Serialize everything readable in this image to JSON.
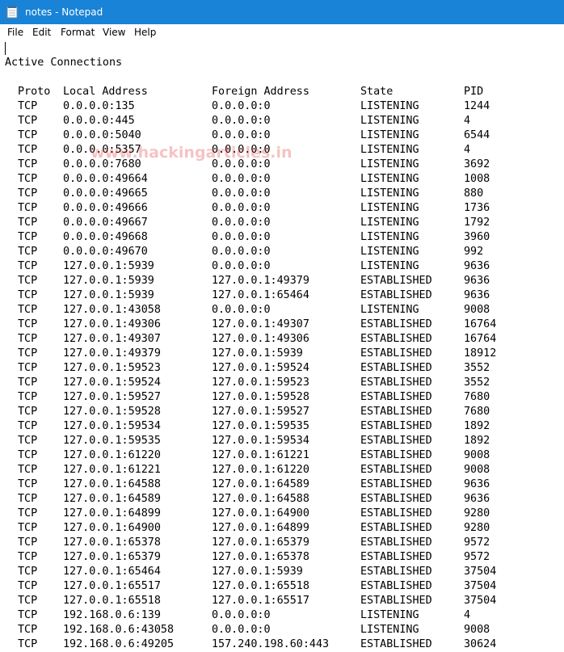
{
  "window": {
    "title": "notes - Notepad",
    "titlebar_color": "#1883d7"
  },
  "menu": [
    "File",
    "Edit",
    "Format",
    "View",
    "Help"
  ],
  "content": {
    "heading": "Active Connections",
    "watermark": "www.hackingarticles.in",
    "columns": [
      "Proto",
      "Local Address",
      "Foreign Address",
      "State",
      "PID"
    ],
    "rows": [
      [
        "TCP",
        "0.0.0.0:135",
        "0.0.0.0:0",
        "LISTENING",
        "1244"
      ],
      [
        "TCP",
        "0.0.0.0:445",
        "0.0.0.0:0",
        "LISTENING",
        "4"
      ],
      [
        "TCP",
        "0.0.0.0:5040",
        "0.0.0.0:0",
        "LISTENING",
        "6544"
      ],
      [
        "TCP",
        "0.0.0.0:5357",
        "0.0.0.0:0",
        "LISTENING",
        "4"
      ],
      [
        "TCP",
        "0.0.0.0:7680",
        "0.0.0.0:0",
        "LISTENING",
        "3692"
      ],
      [
        "TCP",
        "0.0.0.0:49664",
        "0.0.0.0:0",
        "LISTENING",
        "1008"
      ],
      [
        "TCP",
        "0.0.0.0:49665",
        "0.0.0.0:0",
        "LISTENING",
        "880"
      ],
      [
        "TCP",
        "0.0.0.0:49666",
        "0.0.0.0:0",
        "LISTENING",
        "1736"
      ],
      [
        "TCP",
        "0.0.0.0:49667",
        "0.0.0.0:0",
        "LISTENING",
        "1792"
      ],
      [
        "TCP",
        "0.0.0.0:49668",
        "0.0.0.0:0",
        "LISTENING",
        "3960"
      ],
      [
        "TCP",
        "0.0.0.0:49670",
        "0.0.0.0:0",
        "LISTENING",
        "992"
      ],
      [
        "TCP",
        "127.0.0.1:5939",
        "0.0.0.0:0",
        "LISTENING",
        "9636"
      ],
      [
        "TCP",
        "127.0.0.1:5939",
        "127.0.0.1:49379",
        "ESTABLISHED",
        "9636"
      ],
      [
        "TCP",
        "127.0.0.1:5939",
        "127.0.0.1:65464",
        "ESTABLISHED",
        "9636"
      ],
      [
        "TCP",
        "127.0.0.1:43058",
        "0.0.0.0:0",
        "LISTENING",
        "9008"
      ],
      [
        "TCP",
        "127.0.0.1:49306",
        "127.0.0.1:49307",
        "ESTABLISHED",
        "16764"
      ],
      [
        "TCP",
        "127.0.0.1:49307",
        "127.0.0.1:49306",
        "ESTABLISHED",
        "16764"
      ],
      [
        "TCP",
        "127.0.0.1:49379",
        "127.0.0.1:5939",
        "ESTABLISHED",
        "18912"
      ],
      [
        "TCP",
        "127.0.0.1:59523",
        "127.0.0.1:59524",
        "ESTABLISHED",
        "3552"
      ],
      [
        "TCP",
        "127.0.0.1:59524",
        "127.0.0.1:59523",
        "ESTABLISHED",
        "3552"
      ],
      [
        "TCP",
        "127.0.0.1:59527",
        "127.0.0.1:59528",
        "ESTABLISHED",
        "7680"
      ],
      [
        "TCP",
        "127.0.0.1:59528",
        "127.0.0.1:59527",
        "ESTABLISHED",
        "7680"
      ],
      [
        "TCP",
        "127.0.0.1:59534",
        "127.0.0.1:59535",
        "ESTABLISHED",
        "1892"
      ],
      [
        "TCP",
        "127.0.0.1:59535",
        "127.0.0.1:59534",
        "ESTABLISHED",
        "1892"
      ],
      [
        "TCP",
        "127.0.0.1:61220",
        "127.0.0.1:61221",
        "ESTABLISHED",
        "9008"
      ],
      [
        "TCP",
        "127.0.0.1:61221",
        "127.0.0.1:61220",
        "ESTABLISHED",
        "9008"
      ],
      [
        "TCP",
        "127.0.0.1:64588",
        "127.0.0.1:64589",
        "ESTABLISHED",
        "9636"
      ],
      [
        "TCP",
        "127.0.0.1:64589",
        "127.0.0.1:64588",
        "ESTABLISHED",
        "9636"
      ],
      [
        "TCP",
        "127.0.0.1:64899",
        "127.0.0.1:64900",
        "ESTABLISHED",
        "9280"
      ],
      [
        "TCP",
        "127.0.0.1:64900",
        "127.0.0.1:64899",
        "ESTABLISHED",
        "9280"
      ],
      [
        "TCP",
        "127.0.0.1:65378",
        "127.0.0.1:65379",
        "ESTABLISHED",
        "9572"
      ],
      [
        "TCP",
        "127.0.0.1:65379",
        "127.0.0.1:65378",
        "ESTABLISHED",
        "9572"
      ],
      [
        "TCP",
        "127.0.0.1:65464",
        "127.0.0.1:5939",
        "ESTABLISHED",
        "37504"
      ],
      [
        "TCP",
        "127.0.0.1:65517",
        "127.0.0.1:65518",
        "ESTABLISHED",
        "37504"
      ],
      [
        "TCP",
        "127.0.0.1:65518",
        "127.0.0.1:65517",
        "ESTABLISHED",
        "37504"
      ],
      [
        "TCP",
        "192.168.0.6:139",
        "0.0.0.0:0",
        "LISTENING",
        "4"
      ],
      [
        "TCP",
        "192.168.0.6:43058",
        "0.0.0.0:0",
        "LISTENING",
        "9008"
      ],
      [
        "TCP",
        "192.168.0.6:49205",
        "157.240.198.60:443",
        "ESTABLISHED",
        "30624"
      ]
    ]
  }
}
